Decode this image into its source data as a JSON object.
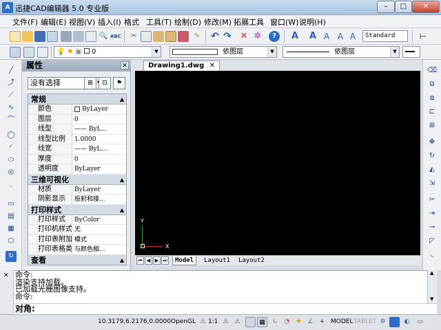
{
  "window": {
    "title": "迅捷CAD编辑器 5.0 专业版",
    "app_icon_text": "A",
    "min_label": "–",
    "max_label": "□",
    "close_label": "✕"
  },
  "menu": [
    "文件(F)",
    "编辑(E)",
    "视图(V)",
    "插入(I)",
    "格式",
    "工具(T)",
    "绘制(D)",
    "修改(M)",
    "拓展工具",
    "窗口(W)",
    "说明(H)"
  ],
  "toolbar": {
    "text_style": "Standard"
  },
  "layerbar": {
    "layer_value": "0",
    "color_value": "依图层",
    "linetype_value": "依图层"
  },
  "properties": {
    "title": "属性",
    "close": "✕",
    "selection": "没有选择",
    "sections": [
      {
        "name": "常规",
        "rows": [
          {
            "k": "颜色",
            "v": "ByLayer"
          },
          {
            "k": "图层",
            "v": "0"
          },
          {
            "k": "线型",
            "v": "—— ByL..."
          },
          {
            "k": "线型比例",
            "v": "1.0000"
          },
          {
            "k": "线宽",
            "v": "—— ByL..."
          },
          {
            "k": "厚度",
            "v": "0"
          },
          {
            "k": "透明度",
            "v": "ByLayer"
          }
        ]
      },
      {
        "name": "三维可视化",
        "rows": [
          {
            "k": "材质",
            "v": "ByLayer"
          },
          {
            "k": "阴影显示",
            "v": "投射和接..."
          }
        ]
      },
      {
        "name": "打印样式",
        "rows": [
          {
            "k": "打印样式",
            "v": "ByColor"
          },
          {
            "k": "打印机样式表",
            "v": "无"
          },
          {
            "k": "打印表附加到",
            "v": "模式"
          },
          {
            "k": "打印表格类型",
            "v": "与颜色相..."
          }
        ]
      },
      {
        "name": "查看",
        "rows": []
      }
    ]
  },
  "document": {
    "tab": "Drawing1.dwg",
    "tab_close": "✕",
    "axis_x": "X",
    "axis_y": "Y"
  },
  "layouts": [
    "Model",
    "Layout1",
    "Layout2"
  ],
  "command": {
    "lines": [
      "命令:",
      "渲染支持加载。",
      "已加载光栅图像支持。",
      "命令:"
    ],
    "prompt": "对角:"
  },
  "status": {
    "coords": "10.3179,6.2176,0.0000",
    "opengl": "OpenGL",
    "scale": "1:1",
    "model": "MODEL",
    "tablet": "TABLET"
  },
  "colors": {
    "accent": "#2b73c9",
    "canvas": "#000000",
    "titlebar": "#b9cfe8"
  }
}
